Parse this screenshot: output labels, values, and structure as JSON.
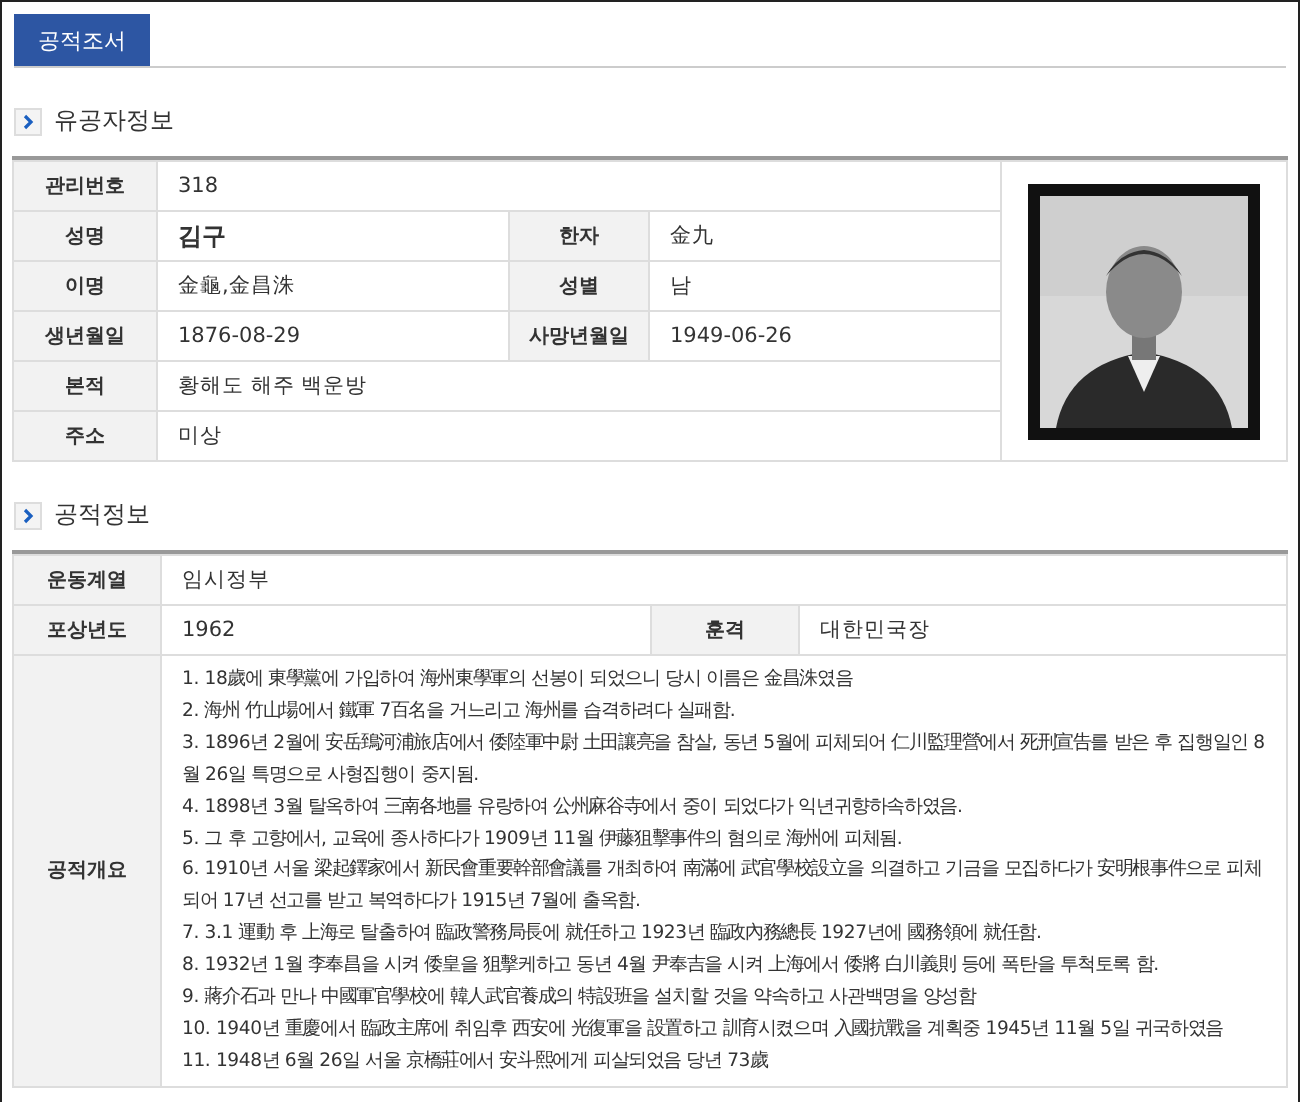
{
  "tabs": [
    {
      "label": "공적조서",
      "selected": true
    }
  ],
  "person_section": {
    "title": "유공자정보",
    "photo": {
      "kind": "picture"
    },
    "rows": [
      [
        {
          "label": "관리번호",
          "value": "318"
        }
      ],
      [
        {
          "label": "성명",
          "value": "김구",
          "bold": true
        },
        {
          "label": "한자",
          "value": "金九"
        }
      ],
      [
        {
          "label": "이명",
          "value": "金龜,金昌洙"
        },
        {
          "label": "성별",
          "value": "남"
        }
      ],
      [
        {
          "label": "생년월일",
          "value": "1876-08-29"
        },
        {
          "label": "사망년월일",
          "value": "1949-06-26"
        }
      ],
      [
        {
          "label": "본적",
          "value": "황해도 해주 백운방"
        }
      ],
      [
        {
          "label": "주소",
          "value": "미상"
        }
      ]
    ]
  },
  "merit_section": {
    "title": "공적정보",
    "rows": [
      [
        {
          "label": "운동계열",
          "value": "임시정부"
        }
      ],
      [
        {
          "label": "포상년도",
          "value": "1962"
        },
        {
          "label": "훈격",
          "value": "대한민국장"
        }
      ]
    ],
    "summary_label": "공적개요",
    "summary": [
      "1. 18歲에 東學黨에 가입하여 海州東學軍의 선봉이 되었으니 당시 이름은 金昌洙였음",
      "2. 海州 竹山場에서 鐵軍 7百名을 거느리고 海州를 습격하려다 실패함.",
      "3. 1896년 2월에 安岳鵄河浦旅店에서 倭陸軍中尉 土田讓亮을 참살, 동년 5월에 피체되어 仁川監理營에서 死刑宣告를 받은 후 집행일인 8월 26일 특명으로 사형집행이 중지됨.",
      "4. 1898년 3월 탈옥하여 三南各地를 유랑하여 公州麻谷寺에서 중이 되었다가 익년귀향하속하였음.",
      "5. 그 후 고향에서, 교육에 종사하다가 1909년 11월 伊藤狙擊事件의 혐의로 海州에 피체됨.",
      "6. 1910년 서울 梁起鐸家에서 新民會重要幹部會議를 개최하여 南滿에 武官學校設立을 의결하고 기금을 모집하다가 安明根事件으로 피체되어 17년 선고를 받고 복역하다가 1915년 7월에 출옥함.",
      "7. 3.1 運動 후 上海로 탈출하여 臨政警務局長에 就任하고 1923년 臨政內務總長 1927년에 國務領에 就任함.",
      "8. 1932년 1월 李奉昌을 시켜 倭皇을 狙擊케하고 동년 4월 尹奉吉을 시켜 上海에서 倭將 白川義則 등에 폭탄을 투척토록 함.",
      "9. 蔣介石과 만나 中國軍官學校에 韓人武官養成의 特設班을 설치할 것을 약속하고 사관백명을 양성함",
      "10. 1940년 重慶에서 臨政主席에 취임후 西安에 光復軍을 設置하고 訓育시켰으며 入國抗戰을 계획중 1945년 11월 5일 귀국하였음",
      "11. 1948년 6월 26일 서울 京橋莊에서 安斗熙에게 피살되었음 당년 73歲"
    ]
  }
}
